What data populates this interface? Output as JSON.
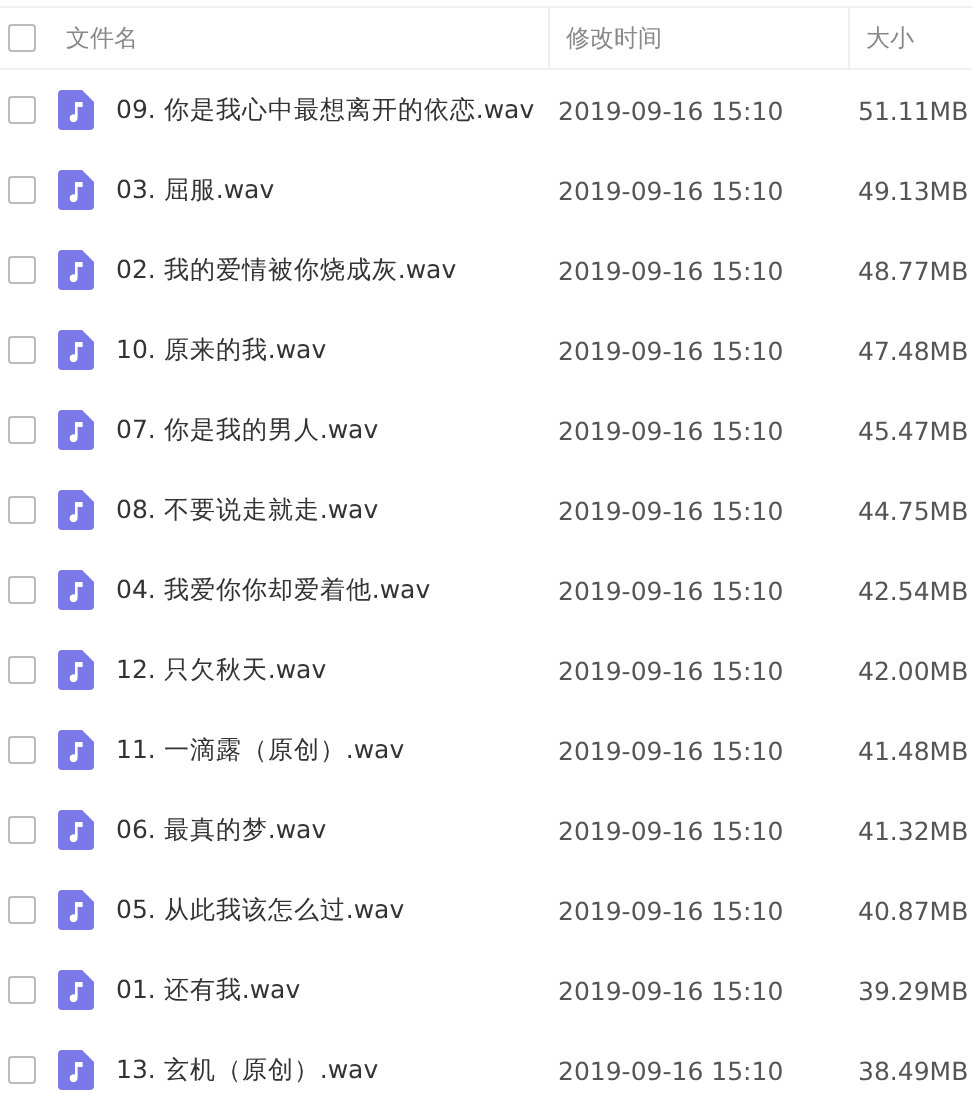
{
  "header": {
    "checked": false,
    "columns": [
      "文件名",
      "修改时间",
      "大小"
    ]
  },
  "files": [
    {
      "name": "09. 你是我心中最想离开的依恋.wav",
      "modified": "2019-09-16 15:10",
      "size": "51.11MB",
      "checked": false
    },
    {
      "name": "03. 屈服.wav",
      "modified": "2019-09-16 15:10",
      "size": "49.13MB",
      "checked": false
    },
    {
      "name": "02. 我的爱情被你烧成灰.wav",
      "modified": "2019-09-16 15:10",
      "size": "48.77MB",
      "checked": false
    },
    {
      "name": "10. 原来的我.wav",
      "modified": "2019-09-16 15:10",
      "size": "47.48MB",
      "checked": false
    },
    {
      "name": "07. 你是我的男人.wav",
      "modified": "2019-09-16 15:10",
      "size": "45.47MB",
      "checked": false
    },
    {
      "name": "08. 不要说走就走.wav",
      "modified": "2019-09-16 15:10",
      "size": "44.75MB",
      "checked": false
    },
    {
      "name": "04. 我爱你你却爱着他.wav",
      "modified": "2019-09-16 15:10",
      "size": "42.54MB",
      "checked": false
    },
    {
      "name": "12. 只欠秋天.wav",
      "modified": "2019-09-16 15:10",
      "size": "42.00MB",
      "checked": false
    },
    {
      "name": "11.  一滴露（原创）.wav",
      "modified": "2019-09-16 15:10",
      "size": "41.48MB",
      "checked": false
    },
    {
      "name": "06. 最真的梦.wav",
      "modified": "2019-09-16 15:10",
      "size": "41.32MB",
      "checked": false
    },
    {
      "name": "05. 从此我该怎么过.wav",
      "modified": "2019-09-16 15:10",
      "size": "40.87MB",
      "checked": false
    },
    {
      "name": "01. 还有我.wav",
      "modified": "2019-09-16 15:10",
      "size": "39.29MB",
      "checked": false
    },
    {
      "name": "13. 玄机（原创）.wav",
      "modified": "2019-09-16 15:10",
      "size": "38.49MB",
      "checked": false
    }
  ]
}
